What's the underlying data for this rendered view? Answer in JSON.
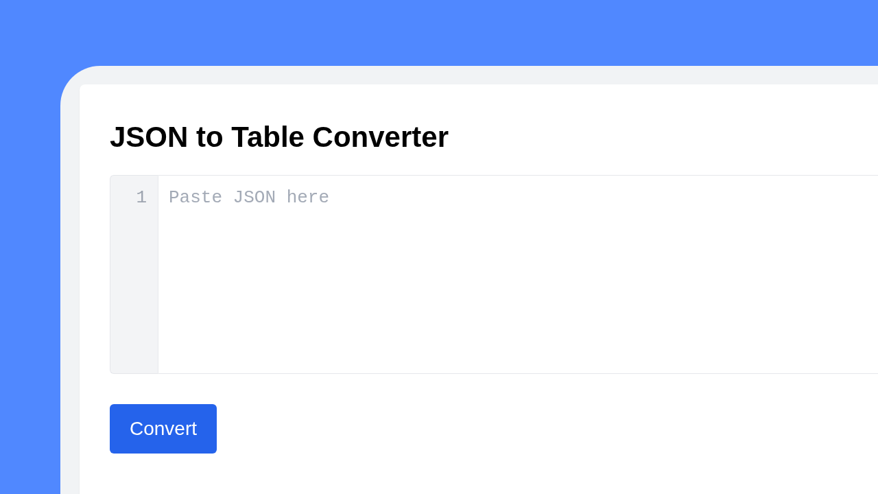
{
  "page": {
    "title": "JSON to Table Converter"
  },
  "editor": {
    "line_numbers": [
      "1"
    ],
    "placeholder": "Paste JSON here"
  },
  "convert_button": {
    "label": "Convert"
  }
}
